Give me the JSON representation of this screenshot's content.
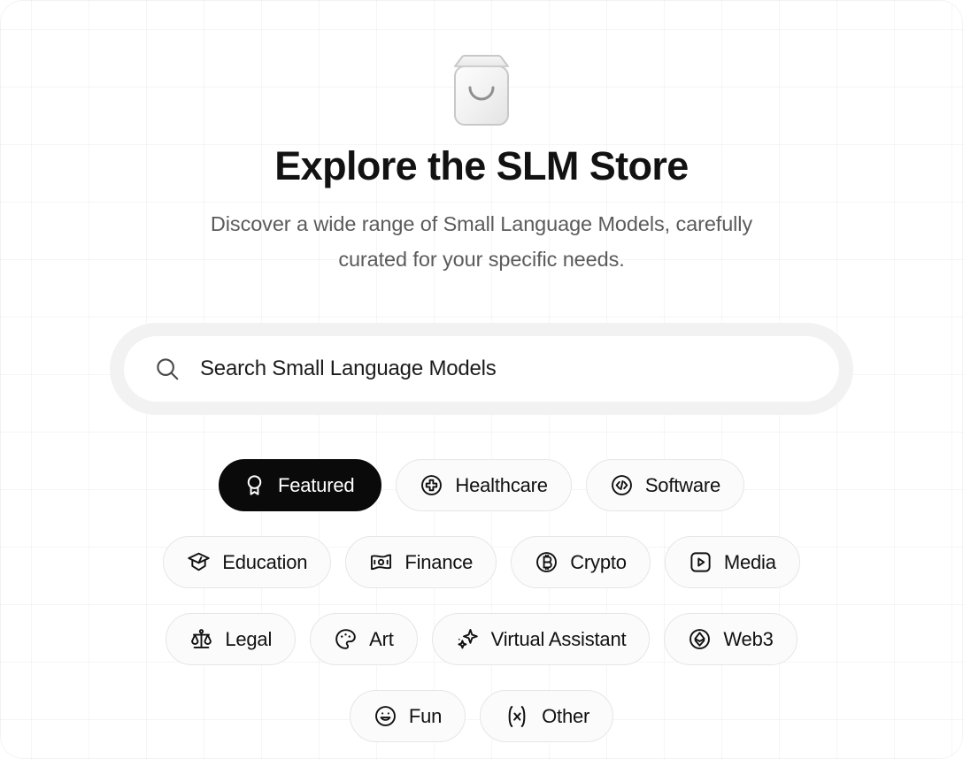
{
  "app": {
    "logo_icon": "shopping-bag-smile-icon",
    "title": "Explore the SLM Store",
    "subtitle": "Discover a wide range of Small Language Models, carefully curated for your specific needs.",
    "background": "#ffffff",
    "accent": "#0a0a0a"
  },
  "search": {
    "icon": "search-icon",
    "placeholder": "Search Small Language Models",
    "value": ""
  },
  "categories": {
    "items": [
      {
        "label": "Featured",
        "icon": "award-ribbon-icon",
        "active": true
      },
      {
        "label": "Healthcare",
        "icon": "medical-cross-icon",
        "active": false
      },
      {
        "label": "Software",
        "icon": "code-brackets-icon",
        "active": false
      },
      {
        "label": "Education",
        "icon": "graduation-cap-icon",
        "active": false
      },
      {
        "label": "Finance",
        "icon": "banknote-icon",
        "active": false
      },
      {
        "label": "Crypto",
        "icon": "bitcoin-icon",
        "active": false
      },
      {
        "label": "Media",
        "icon": "play-square-icon",
        "active": false
      },
      {
        "label": "Legal",
        "icon": "scales-icon",
        "active": false
      },
      {
        "label": "Art",
        "icon": "palette-icon",
        "active": false
      },
      {
        "label": "Virtual Assistant",
        "icon": "sparkles-icon",
        "active": false
      },
      {
        "label": "Web3",
        "icon": "ethereum-icon",
        "active": false
      },
      {
        "label": "Fun",
        "icon": "smiley-face-icon",
        "active": false
      },
      {
        "label": "Other",
        "icon": "math-function-x-icon",
        "active": false
      }
    ]
  }
}
